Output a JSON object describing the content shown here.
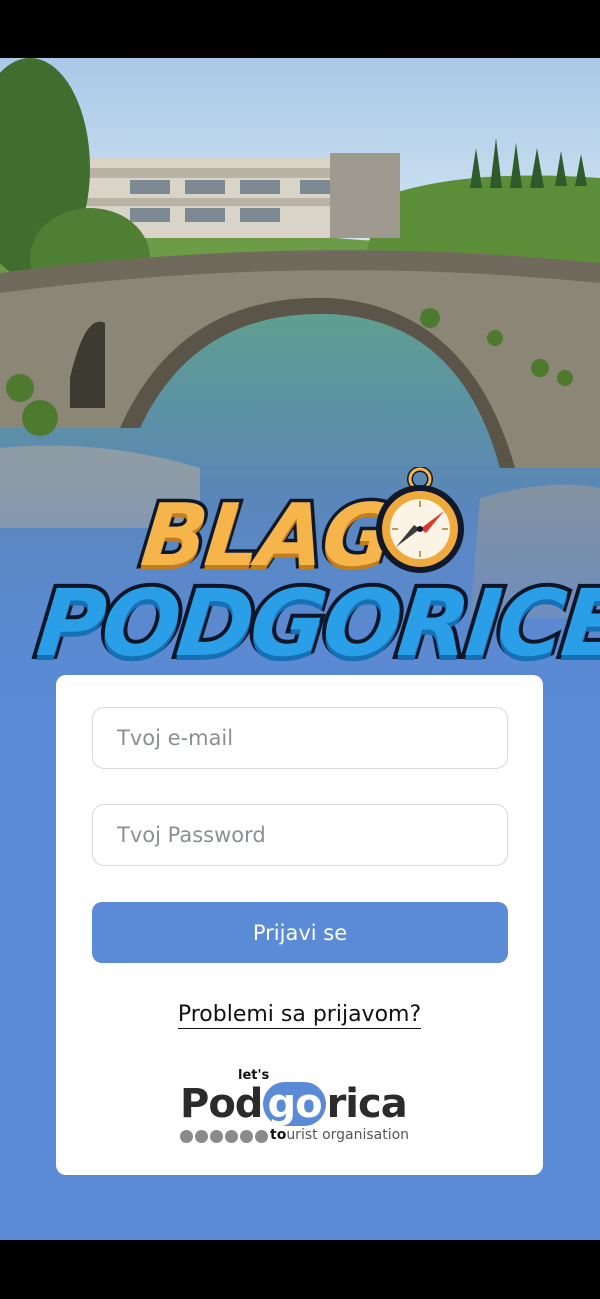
{
  "logo": {
    "top_word": "BLAG",
    "bottom_word": "PODGORICE"
  },
  "login_form": {
    "email_placeholder": "Tvoj e-mail",
    "password_placeholder": "Tvoj Password",
    "submit_label": "Prijavi se",
    "help_link": "Problemi sa prijavom?"
  },
  "footer_brand": {
    "lets": "let's",
    "word_before": "Pod",
    "word_go": "go",
    "word_after": "rica",
    "tag_to": "to",
    "tag_rest": "urist organisation"
  },
  "colors": {
    "accent": "#5b8ad6",
    "logo_orange": "#f5b54a",
    "logo_blue": "#2a9ee6"
  },
  "icons": [
    "compass-icon"
  ]
}
